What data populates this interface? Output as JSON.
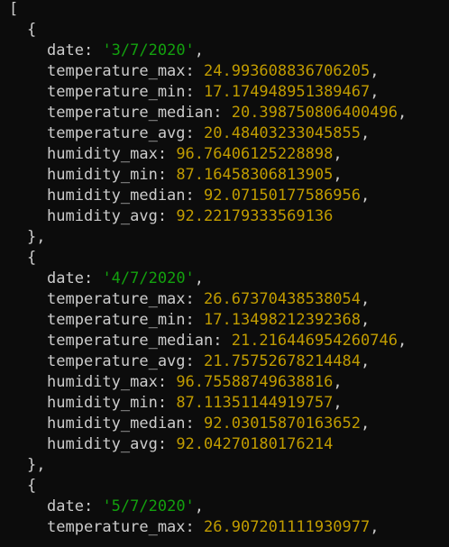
{
  "console": {
    "open_bracket": "[",
    "records": [
      {
        "open": "{",
        "fields": [
          {
            "key": "date",
            "value": "'3/7/2020'",
            "type": "str",
            "comma": true
          },
          {
            "key": "temperature_max",
            "value": "24.993608836706205",
            "type": "num",
            "comma": true
          },
          {
            "key": "temperature_min",
            "value": "17.174948951389467",
            "type": "num",
            "comma": true
          },
          {
            "key": "temperature_median",
            "value": "20.398750806400496",
            "type": "num",
            "comma": true
          },
          {
            "key": "temperature_avg",
            "value": "20.48403233045855",
            "type": "num",
            "comma": true
          },
          {
            "key": "humidity_max",
            "value": "96.76406125228898",
            "type": "num",
            "comma": true
          },
          {
            "key": "humidity_min",
            "value": "87.16458306813905",
            "type": "num",
            "comma": true
          },
          {
            "key": "humidity_median",
            "value": "92.07150177586956",
            "type": "num",
            "comma": true
          },
          {
            "key": "humidity_avg",
            "value": "92.22179333569136",
            "type": "num",
            "comma": false
          }
        ],
        "close": "},"
      },
      {
        "open": "{",
        "fields": [
          {
            "key": "date",
            "value": "'4/7/2020'",
            "type": "str",
            "comma": true
          },
          {
            "key": "temperature_max",
            "value": "26.67370438538054",
            "type": "num",
            "comma": true
          },
          {
            "key": "temperature_min",
            "value": "17.13498212392368",
            "type": "num",
            "comma": true
          },
          {
            "key": "temperature_median",
            "value": "21.216446954260746",
            "type": "num",
            "comma": true
          },
          {
            "key": "temperature_avg",
            "value": "21.75752678214484",
            "type": "num",
            "comma": true
          },
          {
            "key": "humidity_max",
            "value": "96.75588749638816",
            "type": "num",
            "comma": true
          },
          {
            "key": "humidity_min",
            "value": "87.11351144919757",
            "type": "num",
            "comma": true
          },
          {
            "key": "humidity_median",
            "value": "92.03015870163652",
            "type": "num",
            "comma": true
          },
          {
            "key": "humidity_avg",
            "value": "92.04270180176214",
            "type": "num",
            "comma": false
          }
        ],
        "close": "},"
      },
      {
        "open": "{",
        "fields": [
          {
            "key": "date",
            "value": "'5/7/2020'",
            "type": "str",
            "comma": true
          },
          {
            "key": "temperature_max",
            "value": "26.907201111930977",
            "type": "num",
            "comma": true
          }
        ],
        "close": ""
      }
    ]
  },
  "colors": {
    "background": "#0c0c0c",
    "foreground": "#cccccc",
    "string": "#13a10e",
    "number": "#c19c00"
  }
}
